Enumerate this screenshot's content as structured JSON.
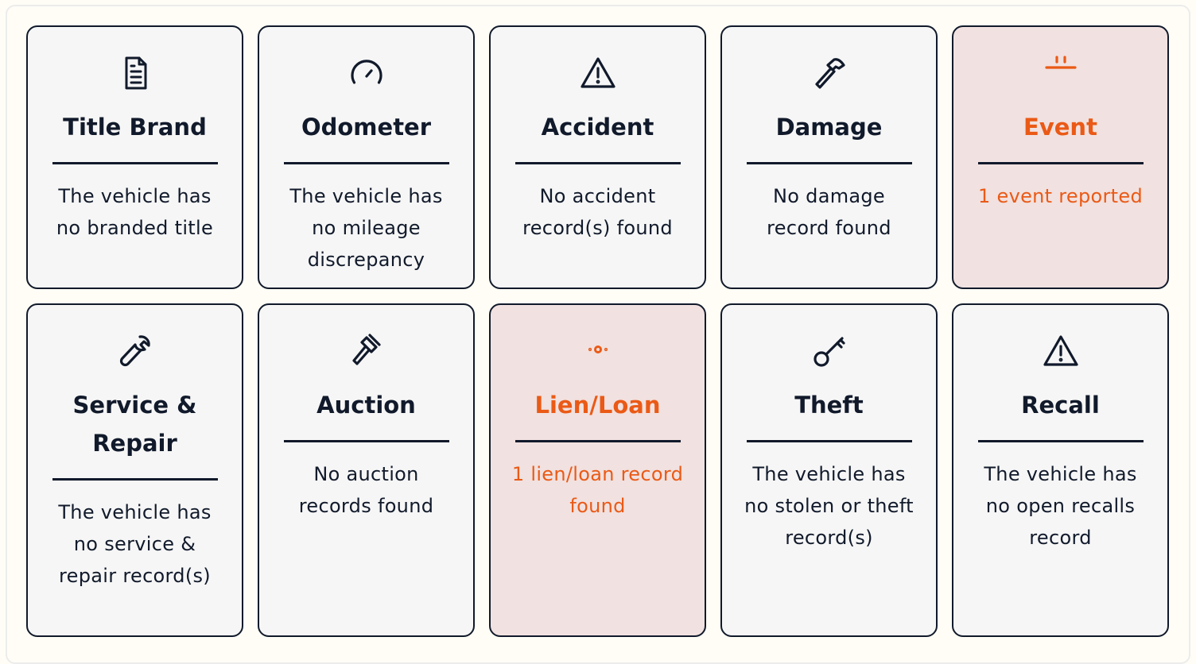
{
  "cards": [
    {
      "title": "Title Brand",
      "description": "The vehicle has no branded title",
      "icon": "document-icon",
      "status": "ok"
    },
    {
      "title": "Odometer",
      "description": "The vehicle has no mileage discrepancy",
      "icon": "gauge-icon",
      "status": "ok"
    },
    {
      "title": "Accident",
      "description": "No accident record(s) found",
      "icon": "warning-icon",
      "status": "ok"
    },
    {
      "title": "Damage",
      "description": "No damage record found",
      "icon": "hammer-icon",
      "status": "ok"
    },
    {
      "title": "Event",
      "description": "1 event reported",
      "icon": "event-icon",
      "status": "alert"
    },
    {
      "title": "Service & Repair",
      "description": "The vehicle has no service & repair record(s)",
      "icon": "wrench-icon",
      "status": "ok"
    },
    {
      "title": "Auction",
      "description": "No auction records found",
      "icon": "gavel-icon",
      "status": "ok"
    },
    {
      "title": "Lien/Loan",
      "description": "1 lien/loan record found",
      "icon": "lien-icon",
      "status": "alert"
    },
    {
      "title": "Theft",
      "description": "The vehicle has no stolen or theft record(s)",
      "icon": "key-icon",
      "status": "ok"
    },
    {
      "title": "Recall",
      "description": "The vehicle has no open recalls record",
      "icon": "warning-icon",
      "status": "ok"
    }
  ],
  "colors": {
    "ink": "#111a2b",
    "alert": "#ea5a16",
    "card_bg": "#f6f6f6",
    "alert_bg": "#f1e1e0"
  }
}
